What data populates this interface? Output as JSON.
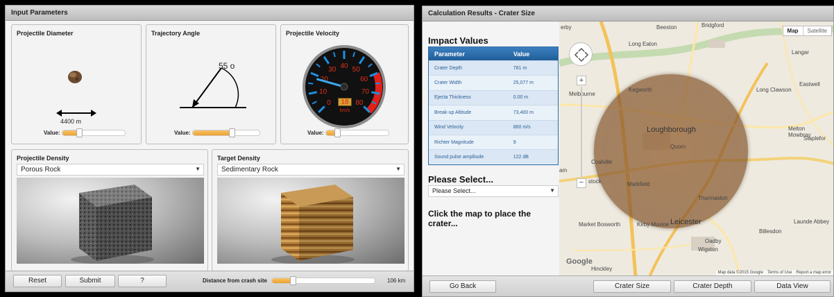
{
  "left_panel": {
    "title": "Input Parameters",
    "diameter": {
      "title": "Projectile Diameter",
      "measure": "4400 m",
      "value_label": "Value:",
      "slider_fraction": 0.27
    },
    "angle": {
      "title": "Trajectory Angle",
      "readout": "55 o",
      "value_label": "Value:",
      "slider_fraction": 0.58
    },
    "velocity": {
      "title": "Projectile Velocity",
      "gauge_ticks": [
        "0",
        "10",
        "20",
        "30",
        "40",
        "50",
        "60",
        "70",
        "80"
      ],
      "reading": "18",
      "unit": "km/s",
      "value_label": "Value:",
      "slider_fraction": 0.18
    },
    "projectile_density": {
      "title": "Projectile Density",
      "selected": "Porous Rock"
    },
    "target_density": {
      "title": "Target Density",
      "selected": "Sedimentary Rock"
    },
    "buttons": {
      "reset": "Reset",
      "submit": "Submit",
      "help": "?"
    },
    "distance": {
      "label": "Distance from crash site",
      "value": "106 km",
      "slider_fraction": 0.2
    }
  },
  "right_panel": {
    "title": "Calculation Results - Crater Size",
    "impact_heading": "Impact Values",
    "table": {
      "headers": [
        "Parameter",
        "Value"
      ],
      "rows": [
        [
          "Crater Depth",
          "781 m"
        ],
        [
          "Crater Width",
          "25,077 m"
        ],
        [
          "Ejecta Thickness",
          "0.00 m"
        ],
        [
          "Break-up Altitude",
          "73,400 m"
        ],
        [
          "Wind Velocity",
          "860 m/s"
        ],
        [
          "Richter Magnitude",
          "9"
        ],
        [
          "Sound pulse amplitude",
          "122 dB"
        ]
      ]
    },
    "please_select_heading": "Please Select...",
    "please_select_value": "Please Select...",
    "instruction": "Click the map to place the crater...",
    "map": {
      "type_map": "Map",
      "type_satellite": "Satellite",
      "towns": [
        "erby",
        "Beeston",
        "Bridgford",
        "Long Eaton",
        "Langar",
        "Kegworth",
        "Melbourne",
        "Long Clawson",
        "Eastwell",
        "Loughborough",
        "Quorn",
        "Melton Mowbray",
        "Staplefor",
        "Coalville",
        "Markfield",
        "Thurmaston",
        "Leicester",
        "Market Bosworth",
        "Kirby Muxloe",
        "Launde Abbey",
        "Billesdon",
        "Oadby",
        "Wigston",
        "Hinckley",
        "am",
        "stock"
      ],
      "attribution": "Map data ©2015 Google",
      "terms": "Terms of Use",
      "report": "Report a map error",
      "logo": "Google"
    },
    "buttons": {
      "back": "Go Back",
      "crater_size": "Crater Size",
      "crater_depth": "Crater Depth",
      "data_view": "Data View"
    }
  },
  "colors": {
    "accent_orange": "#eea12c",
    "table_blue": "#1f5e99",
    "crater_brown": "#8b5a2b",
    "gauge_red": "#e0201b",
    "gauge_blue": "#1e8fe0"
  }
}
